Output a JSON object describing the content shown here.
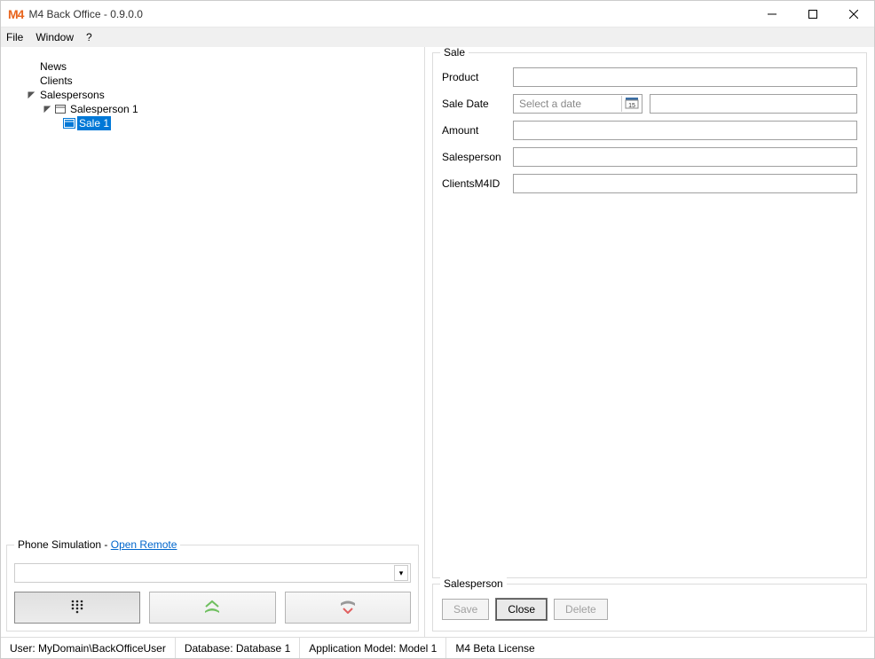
{
  "window": {
    "title": "M4 Back Office - 0.9.0.0",
    "logo": "M4"
  },
  "menu": {
    "file": "File",
    "window": "Window",
    "help": "?"
  },
  "tree": {
    "news": "News",
    "clients": "Clients",
    "salespersons": "Salespersons",
    "salesperson1": "Salesperson 1",
    "sale1": "Sale 1"
  },
  "phone": {
    "group_label": "Phone Simulation - ",
    "open_remote": "Open Remote",
    "combo_value": ""
  },
  "sale_form": {
    "group_label": "Sale",
    "product_label": "Product",
    "product_value": "",
    "saledate_label": "Sale Date",
    "saledate_placeholder": "Select a date",
    "time_value": "",
    "amount_label": "Amount",
    "amount_value": "",
    "salesperson_label": "Salesperson",
    "salesperson_value": "",
    "clients_label": "ClientsM4ID",
    "clients_value": "",
    "calendar_day": "15"
  },
  "actions": {
    "group_label": "Salesperson",
    "save": "Save",
    "close": "Close",
    "delete": "Delete"
  },
  "status": {
    "user": "User: MyDomain\\BackOfficeUser",
    "database": "Database: Database 1",
    "model": "Application Model: Model 1",
    "license": "M4 Beta License"
  }
}
